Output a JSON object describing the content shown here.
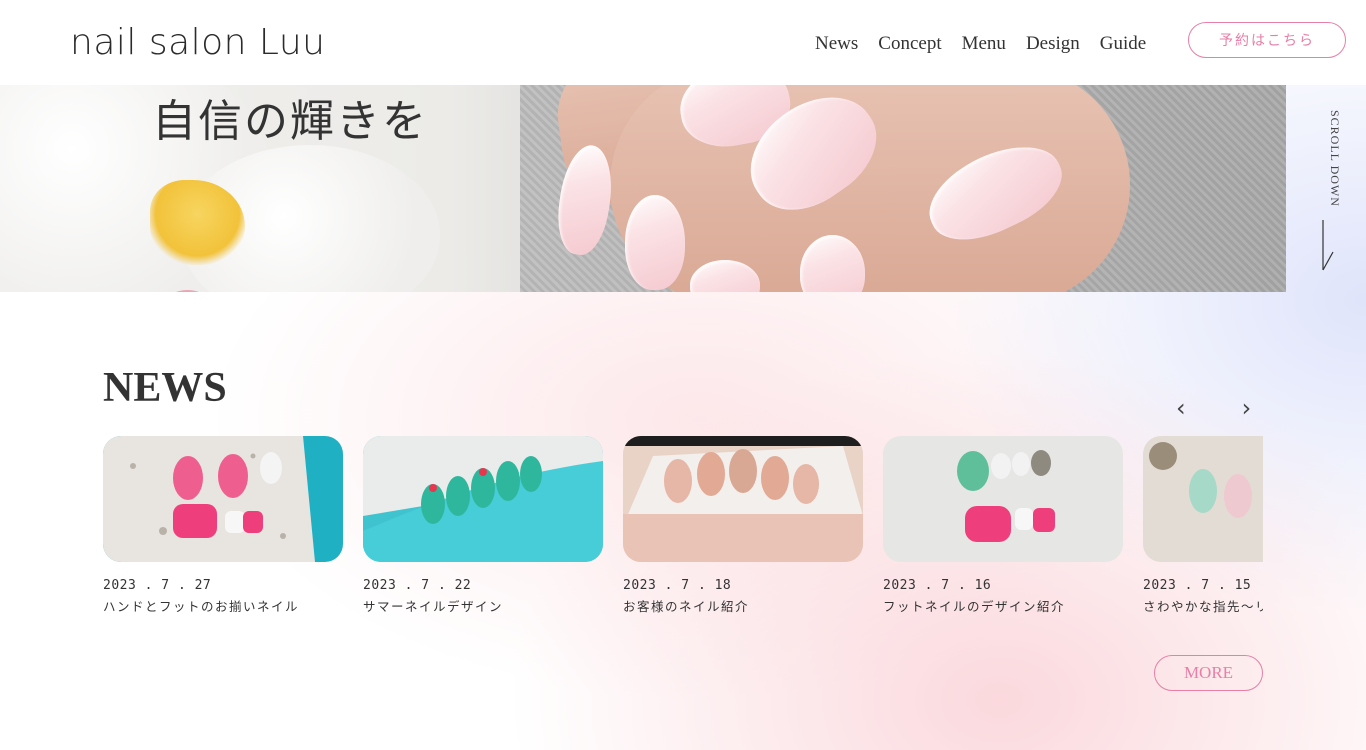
{
  "header": {
    "logo": "nail salon Luu",
    "nav": [
      "News",
      "Concept",
      "Menu",
      "Design",
      "Guide"
    ],
    "reserve_label": "予約はこちら"
  },
  "hero": {
    "text": "自信の輝きを",
    "scroll_label": "SCROLL DOWN"
  },
  "news": {
    "title": "NEWS",
    "prev_icon": "chevron-left-icon",
    "next_icon": "chevron-right-icon",
    "items": [
      {
        "date": "2023 . 7 . 27",
        "caption": "ハンドとフットのお揃いネイル"
      },
      {
        "date": "2023 . 7 . 22",
        "caption": "サマーネイルデザイン"
      },
      {
        "date": "2023 . 7 . 18",
        "caption": "お客様のネイル紹介"
      },
      {
        "date": "2023 . 7 . 16",
        "caption": "フットネイルのデザイン紹介"
      },
      {
        "date": "2023 . 7 . 15",
        "caption": "さわやかな指先～リ"
      }
    ],
    "more_label": "MORE"
  },
  "colors": {
    "accent": "#e77fa6",
    "text": "#333333",
    "teal": "#3fc3cf"
  }
}
